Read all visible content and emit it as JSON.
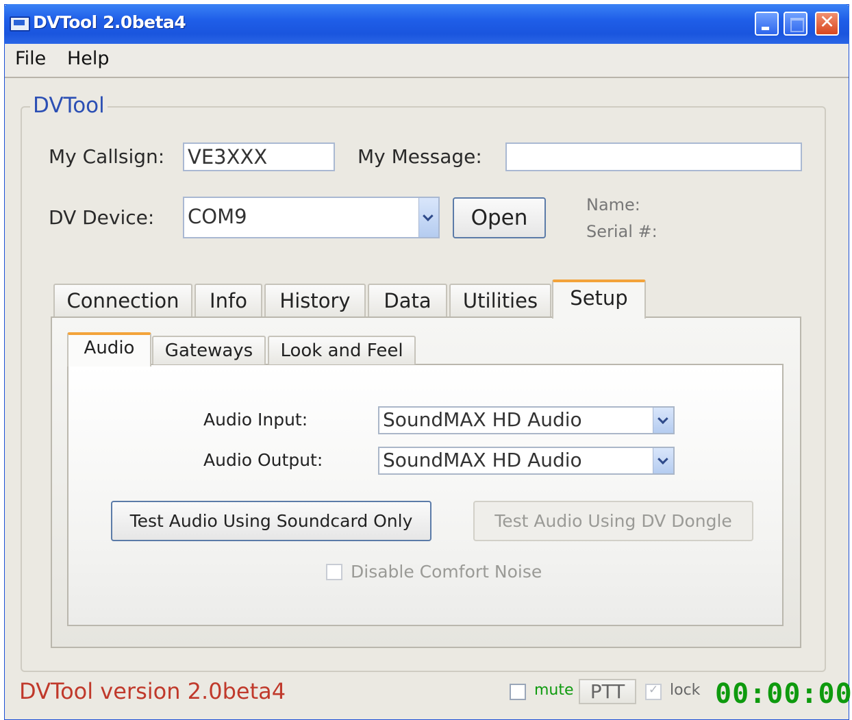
{
  "window": {
    "title": "DVTool 2.0beta4"
  },
  "menubar": {
    "items": [
      "File",
      "Help"
    ]
  },
  "group": {
    "legend": "DVTool"
  },
  "form": {
    "callsign_label": "My Callsign:",
    "callsign_value": "VE3XXX",
    "message_label": "My Message:",
    "message_value": "",
    "device_label": "DV Device:",
    "device_value": "COM9",
    "open_button": "Open",
    "name_label": "Name:",
    "serial_label": "Serial #:"
  },
  "tabs": {
    "items": [
      "Connection",
      "Info",
      "History",
      "Data",
      "Utilities",
      "Setup"
    ],
    "selected": "Setup"
  },
  "subtabs": {
    "items": [
      "Audio",
      "Gateways",
      "Look and Feel"
    ],
    "selected": "Audio"
  },
  "audio": {
    "input_label": "Audio Input:",
    "input_value": "SoundMAX HD Audio",
    "output_label": "Audio Output:",
    "output_value": "SoundMAX HD Audio",
    "test_soundcard_button": "Test Audio Using Soundcard Only",
    "test_dongle_button": "Test Audio Using DV Dongle",
    "comfort_noise_label": "Disable Comfort Noise",
    "comfort_noise_checked": false
  },
  "statusbar": {
    "version": "DVTool version 2.0beta4",
    "mute_label": "mute",
    "mute_checked": false,
    "ptt_label": "PTT",
    "lock_label": "lock",
    "lock_checked": true,
    "timer": "00:00:00"
  },
  "colors": {
    "title_bar": "#1f5ee8",
    "accent_tab": "#f3a33a",
    "version_text": "#c0392b",
    "status_green": "#0e9a0e",
    "legend_blue": "#2b4fb4"
  }
}
